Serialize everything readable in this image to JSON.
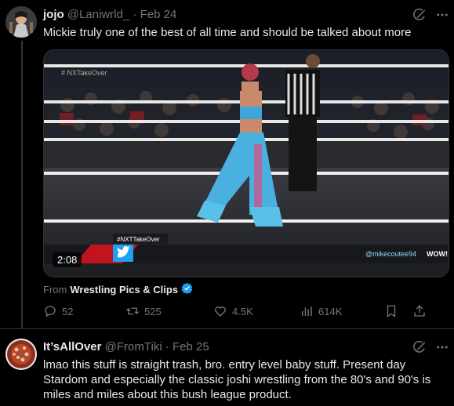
{
  "tweet1": {
    "name": "jojo",
    "handle": "@Laniwrld_",
    "separator": "·",
    "date": "Feb 24",
    "text": "Mickie truly one of the best of all time and should be talked about more",
    "video": {
      "duration": "2:08",
      "overlay_top_left": "# NXTakeOver",
      "overlay_tag": "#NXTTakeOver",
      "overlay_handle": "@mikecoutee94",
      "overlay_wow": "WOW!!!"
    },
    "from_label": "From",
    "from_source": "Wrestling Pics & Clips",
    "actions": {
      "replies": "52",
      "reposts": "525",
      "likes": "4.5K",
      "views": "614K"
    }
  },
  "tweet2": {
    "name": "It’sAllOver",
    "handle": "@FromTiki",
    "separator": "·",
    "date": "Feb 25",
    "text": "lmao this stuff is straight trash, bro. entry level baby stuff. Present day Stardom and especially the classic joshi wrestling from the 80's and 90's is miles and miles about this bush league product."
  },
  "colors": {
    "background": "#000000",
    "text": "#e7e9ea",
    "muted": "#71767b",
    "verified": "#1d9bf0",
    "divider": "#2f3336"
  }
}
